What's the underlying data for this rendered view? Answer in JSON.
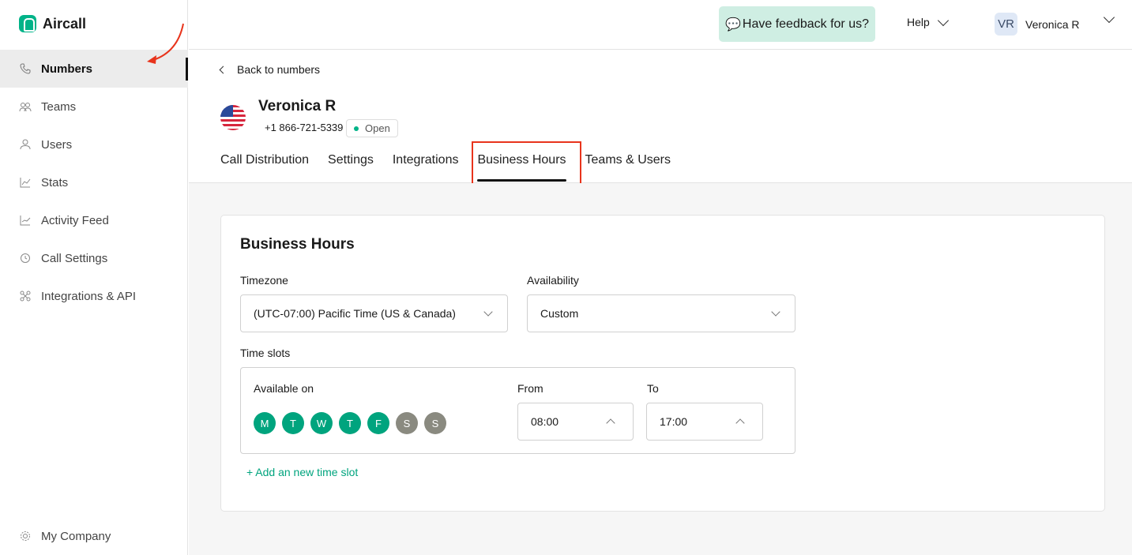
{
  "app": {
    "logo_text": "Aircall",
    "accent": "#00b388"
  },
  "sidebar": {
    "items": [
      {
        "label": "Numbers",
        "icon": "phone-icon"
      },
      {
        "label": "Teams",
        "icon": "teams-icon"
      },
      {
        "label": "Users",
        "icon": "user-icon"
      },
      {
        "label": "Stats",
        "icon": "stats-icon"
      },
      {
        "label": "Activity Feed",
        "icon": "activity-icon"
      },
      {
        "label": "Call Settings",
        "icon": "call-settings-icon"
      },
      {
        "label": "Integrations & API",
        "icon": "integrations-icon"
      }
    ],
    "bottom": {
      "label": "My Company",
      "icon": "gear-icon"
    }
  },
  "topbar": {
    "feedback_icon": "💬",
    "feedback_label": "Have feedback for us?",
    "help_label": "Help",
    "user_initials": "VR",
    "user_name": "Veronica R"
  },
  "header": {
    "back_label": "Back to numbers",
    "name": "Veronica R",
    "phone": "+1 866-721-5339",
    "status": "Open",
    "tabs": [
      "Call Distribution",
      "Settings",
      "Integrations",
      "Business Hours",
      "Teams & Users"
    ],
    "active_tab": "Business Hours"
  },
  "card": {
    "title": "Business Hours",
    "timezone_label": "Timezone",
    "timezone_value": "(UTC-07:00) Pacific Time (US & Canada)",
    "availability_label": "Availability",
    "availability_value": "Custom",
    "time_slots_label": "Time slots",
    "available_on_label": "Available on",
    "days": [
      "M",
      "T",
      "W",
      "T",
      "F",
      "S",
      "S"
    ],
    "from_label": "From",
    "from_value": "08:00",
    "to_label": "To",
    "to_value": "17:00",
    "add_slot_label": "+ Add an new time slot"
  }
}
